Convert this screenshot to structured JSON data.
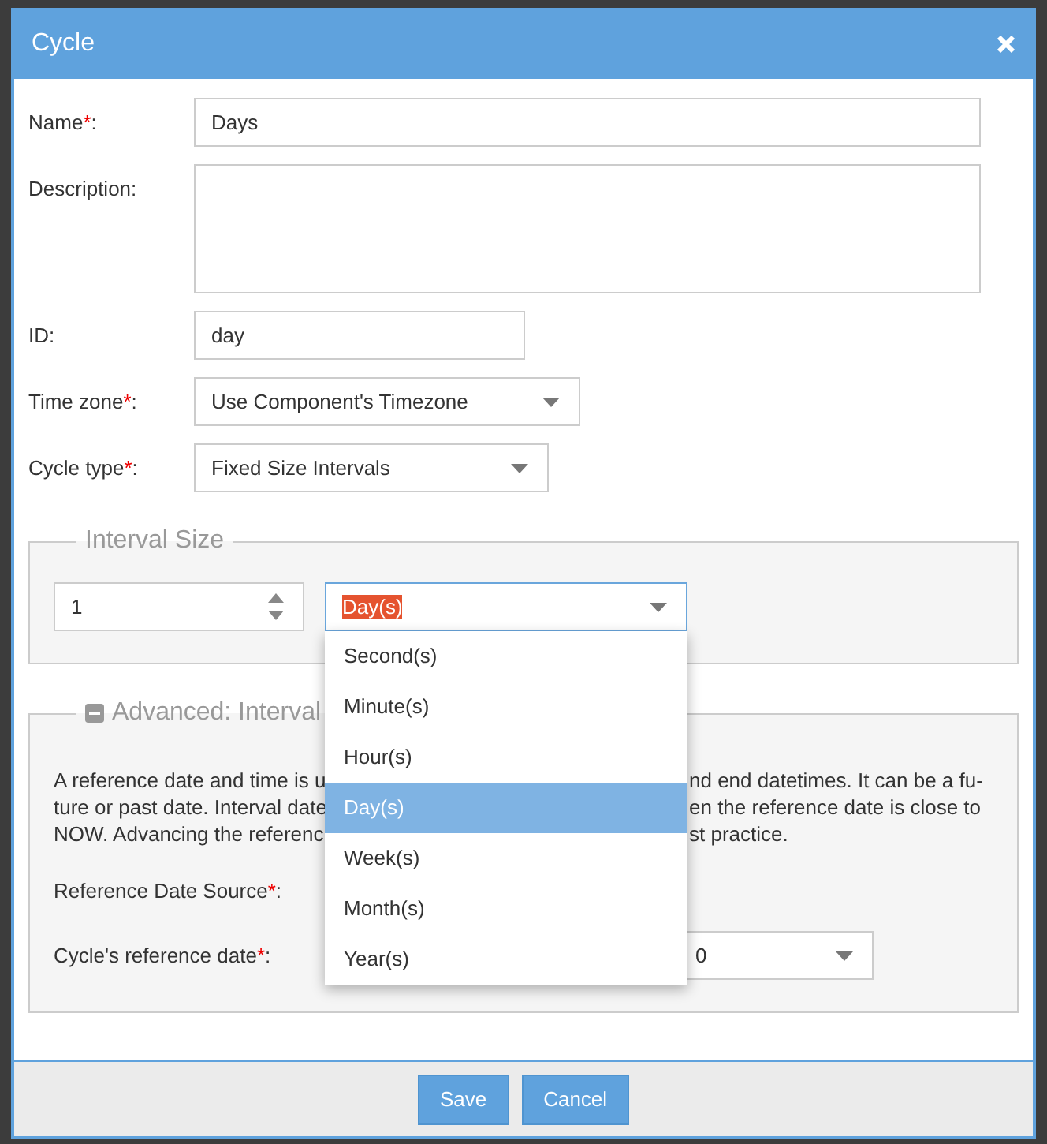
{
  "dialog": {
    "title": "Cycle"
  },
  "fields": [
    {
      "kind": "text",
      "label": "Name",
      "required_mark": "*",
      "label_end": ":",
      "value": "Days"
    },
    {
      "kind": "textarea",
      "label": "Description",
      "label_end": ":"
    },
    {
      "kind": "text",
      "label": "ID",
      "label_end": ":",
      "value": "day"
    },
    {
      "kind": "select",
      "label": "Time zone",
      "required_mark": "*",
      "label_end": ":",
      "value": "Use Component's Timezone"
    },
    {
      "kind": "select",
      "label": "Cycle type",
      "required_mark": "*",
      "label_end": ":",
      "value": "Fixed Size Intervals"
    }
  ],
  "interval_size": {
    "legend": "Interval Size",
    "number": "1",
    "unit": {
      "value": "Day(s)",
      "text_highlighted": true,
      "open": true,
      "options": [
        {
          "label": "Second(s)",
          "selected": false
        },
        {
          "label": "Minute(s)",
          "selected": false
        },
        {
          "label": "Hour(s)",
          "selected": false
        },
        {
          "label": "Day(s)",
          "selected": true
        },
        {
          "label": "Week(s)",
          "selected": false
        },
        {
          "label": "Month(s)",
          "selected": false
        },
        {
          "label": "Year(s)",
          "selected": false
        }
      ]
    }
  },
  "advanced": {
    "legend": "Advanced: Interval",
    "expanded": true,
    "paragraph_lines": [
      {
        "left": "A reference date and time is u",
        "right": "nd end datetimes. It can be a fu-"
      },
      {
        "left": "ture or past date. Interval date",
        "right": "en the reference date is close to"
      },
      {
        "left": "NOW. Advancing the referenc",
        "right": "st practice."
      }
    ],
    "fields": [
      {
        "label": "Reference Date Source",
        "required_mark": "*",
        "label_end": ":"
      },
      {
        "label": "Cycle's reference date",
        "required_mark": "*",
        "label_end": ":",
        "value": "0"
      }
    ]
  },
  "buttons": [
    {
      "label": "Save"
    },
    {
      "label": "Cancel"
    }
  ]
}
